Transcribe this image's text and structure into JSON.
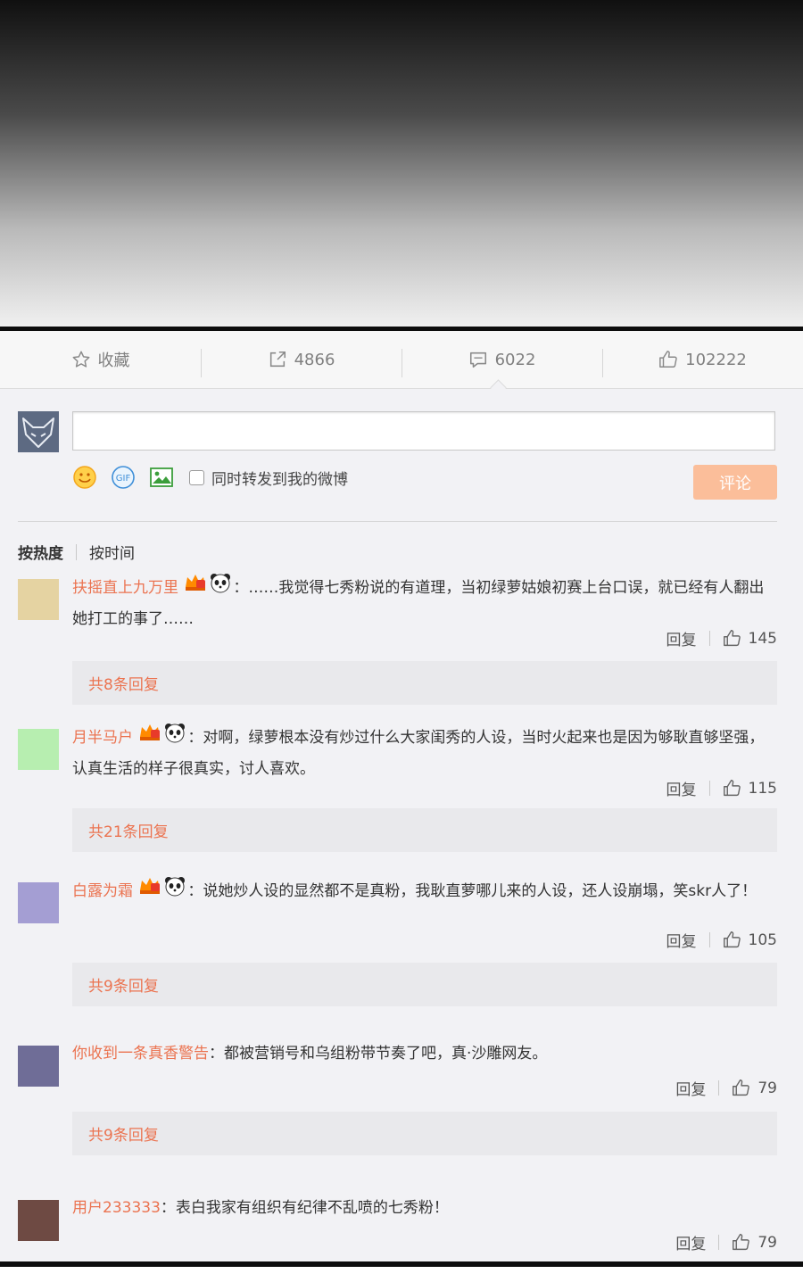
{
  "action_bar": {
    "favorite_label": "收藏",
    "repost_count": "4866",
    "comment_count": "6022",
    "like_count": "102222"
  },
  "composer": {
    "input_value": "",
    "forward_label": "同时转发到我的微博",
    "submit_label": "评论",
    "gif_label": "GIF"
  },
  "sort": {
    "hot": "按热度",
    "time": "按时间"
  },
  "reply_label": "回复",
  "comments": [
    {
      "user": "扶摇直上九万里",
      "colon": "：",
      "text": "……我觉得七秀粉说的有道理，当初绿萝姑娘初赛上台口误，就已经有人翻出她打工的事了……",
      "likes": "145",
      "replies": "共8条回复",
      "avatar_color": "#e5d3a2",
      "badges": true
    },
    {
      "user": "月半马户",
      "colon": "：",
      "text": "对啊，绿萝根本没有炒过什么大家闺秀的人设，当时火起来也是因为够耿直够坚强，认真生活的样子很真实，讨人喜欢。",
      "likes": "115",
      "replies": "共21条回复",
      "avatar_color": "#b7eeb0",
      "badges": true
    },
    {
      "user": "白露为霜",
      "colon": "：",
      "text": "说她炒人设的显然都不是真粉，我耿直萝哪儿来的人设，还人设崩塌，笑skr人了！",
      "likes": "105",
      "replies": "共9条回复",
      "avatar_color": "#a49ed3",
      "badges": true
    },
    {
      "user": "你收到一条真香警告",
      "colon": "：",
      "text": "都被营销号和乌组粉带节奏了吧，真·沙雕网友。",
      "likes": "79",
      "replies": "共9条回复",
      "avatar_color": "#6f6d97",
      "badges": false
    },
    {
      "user": "用户233333",
      "colon": "：",
      "text": "表白我家有组织有纪律不乱喷的七秀粉！",
      "likes": "79",
      "replies": "",
      "avatar_color": "#6e4a43",
      "badges": false
    }
  ]
}
